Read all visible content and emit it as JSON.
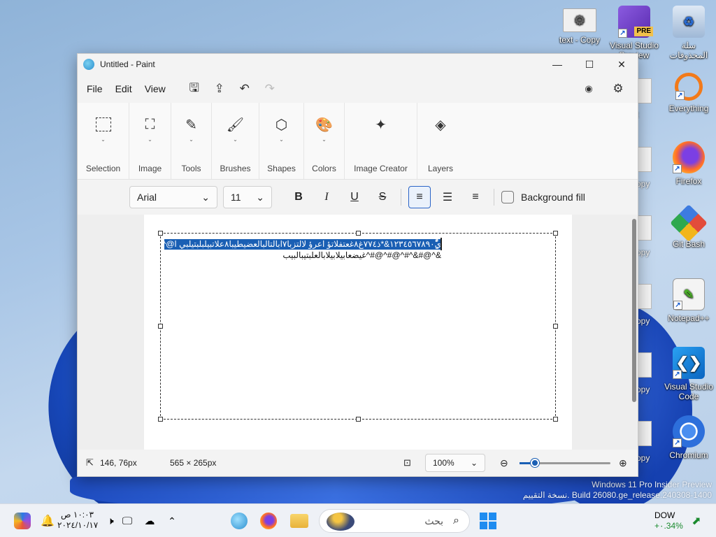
{
  "colors": {
    "accent": "#1a5fb4",
    "window_bg": "#f3f3f3",
    "stock_up": "#1a8a2e"
  },
  "desktop": {
    "icons": [
      {
        "label": "text - Copy",
        "icon": "gear-file-icon"
      },
      {
        "label": "Visual Studio Preview",
        "badge": "PRE",
        "icon": "visual-studio-preview-icon"
      },
      {
        "label": "سلة المحذوفات",
        "icon": "recycle-bin-icon"
      },
      {
        "label": "Everything",
        "icon": "search-magnifier-icon"
      },
      {
        "label": "Firefox",
        "icon": "firefox-icon"
      },
      {
        "label": "Git Bash",
        "icon": "git-bash-icon"
      },
      {
        "label": "Notepad++",
        "icon": "notepadpp-icon"
      },
      {
        "label": "Visual Studio Code",
        "icon": "vscode-icon"
      },
      {
        "label": "Chromium",
        "icon": "chromium-icon"
      }
    ],
    "partial_labels": [
      "t",
      "opy",
      "opy",
      "opy",
      "opy",
      "opy"
    ],
    "watermark": {
      "line1": "Windows 11 Pro Insider Preview",
      "line2": "نسخة التقييم. Build 26080.ge_release.240308-1400"
    }
  },
  "paint": {
    "title": "Untitled - Paint",
    "menu": [
      "File",
      "Edit",
      "View"
    ],
    "ribbon": [
      {
        "label": "Selection",
        "icon": "selection-icon"
      },
      {
        "label": "Image",
        "icon": "image-icon"
      },
      {
        "label": "Tools",
        "icon": "tools-icon"
      },
      {
        "label": "Brushes",
        "icon": "brush-icon"
      },
      {
        "label": "Shapes",
        "icon": "shapes-icon"
      },
      {
        "label": "Colors",
        "icon": "palette-icon"
      },
      {
        "label": "Image Creator",
        "icon": "image-creator-icon"
      },
      {
        "label": "Layers",
        "icon": "layers-icon"
      }
    ],
    "text_toolbar": {
      "font": "Arial",
      "size": "11",
      "background_fill": "Background fill"
    },
    "canvas_text": {
      "line1": "ي١٢٣٤٥٦٧٨٩٠ًٌٍَُِّْ&*ذ٧٧٤غ٨غعتفلاتؤ اعرؤ لالتزبا٧ابالتالبالعضيطيبا٨علاتبيلبلبتيلبي ا@^^!",
      "line2": "&^@#&^#^@#^@#^غيضعابيلابيلابالعلبتيبالبيب"
    },
    "status": {
      "cursor": "146, 76px",
      "size": "565 × 265px",
      "zoom": "100%"
    }
  },
  "taskbar": {
    "clock_time": "١٠:٠٣ ص",
    "clock_date": "٢٠٢٤/١٠/١٧",
    "search_placeholder": "بحث",
    "stock_name": "DOW",
    "stock_change": "+٠.34%"
  }
}
